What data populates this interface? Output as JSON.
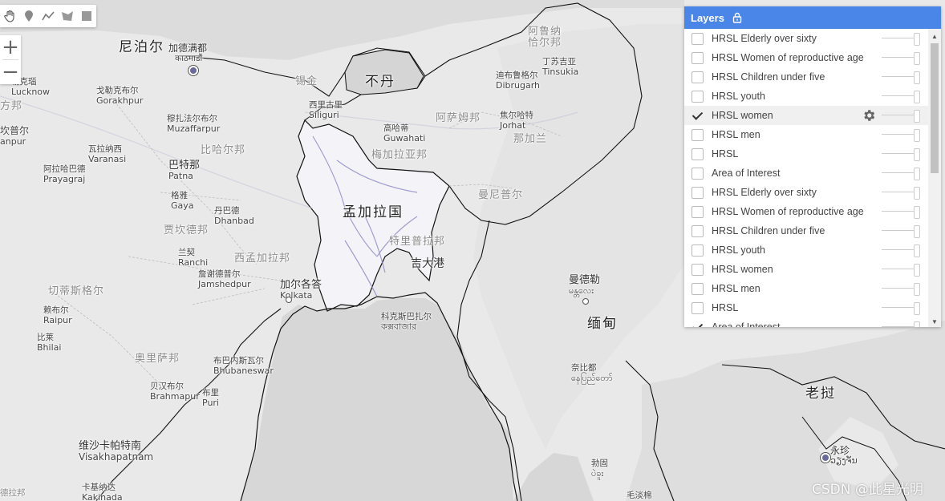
{
  "toolbar": {
    "tools": [
      {
        "name": "pan-hand-icon"
      },
      {
        "name": "marker-pin-icon"
      },
      {
        "name": "draw-line-icon"
      },
      {
        "name": "draw-polygon-icon"
      },
      {
        "name": "draw-rectangle-icon"
      }
    ]
  },
  "zoom": {
    "in_label": "+",
    "out_label": "−"
  },
  "layers_panel": {
    "title": "Layers",
    "lock_icon": "lock-icon",
    "accent_color": "#4a86e8",
    "items": [
      {
        "label": "HRSL Elderly over sixty",
        "checked": false
      },
      {
        "label": "HRSL Women of reproductive age",
        "checked": false
      },
      {
        "label": "HRSL Children under five",
        "checked": false
      },
      {
        "label": "HRSL youth",
        "checked": false
      },
      {
        "label": "HRSL women",
        "checked": true
      },
      {
        "label": "HRSL men",
        "checked": false
      },
      {
        "label": "HRSL",
        "checked": false
      },
      {
        "label": "Area of Interest",
        "checked": false
      },
      {
        "label": "HRSL Elderly over sixty",
        "checked": false
      },
      {
        "label": "HRSL Women of reproductive age",
        "checked": false
      },
      {
        "label": "HRSL Children under five",
        "checked": false
      },
      {
        "label": "HRSL youth",
        "checked": false
      },
      {
        "label": "HRSL women",
        "checked": false
      },
      {
        "label": "HRSL men",
        "checked": false
      },
      {
        "label": "HRSL",
        "checked": false
      },
      {
        "label": "Area of Interest",
        "checked": true
      }
    ]
  },
  "map": {
    "labels": {
      "nepal": "尼泊尔",
      "kathmandu_cn": "加德满都",
      "kathmandu_local": "काठमाडौं",
      "bhutan": "不丹",
      "sikkim": "锡金",
      "siliguri_cn": "西里古里",
      "siliguri": "Siliguri",
      "arunachal": "阿鲁纳",
      "arunachal2": "恰尔邦",
      "tinsukia_cn": "丁苏吉亚",
      "tinsukia": "Tinsukia",
      "dibrugarh_cn": "迪布鲁格尔",
      "dibrugarh": "Dibrugarh",
      "lucknow_cn": "勒克瑙",
      "lucknow": "Lucknow",
      "gorakhpur_cn": "戈勒克布尔",
      "gorakhpur": "Gorakhpur",
      "up_partial": "方邦",
      "kanpur_cn": "坎普尔",
      "kanpur": "anpur",
      "muzaffarpur_cn": "穆扎法尔布尔",
      "muzaffarpur": "Muzaffarpur",
      "bihar": "比哈尔邦",
      "varanasi_cn": "瓦拉纳西",
      "varanasi": "Varanasi",
      "prayagraj_cn": "阿拉哈巴德",
      "prayagraj": "Prayagraj",
      "patna_cn": "巴特那",
      "patna": "Patna",
      "gaya_cn": "格雅",
      "gaya": "Gaya",
      "dhanbad_cn": "丹巴德",
      "dhanbad": "Dhanbad",
      "jharkhand": "贾坎德邦",
      "ranchi_cn": "兰契",
      "ranchi": "Ranchi",
      "jamshedpur_cn": "詹谢德普尔",
      "jamshedpur": "Jamshedpur",
      "west_bengal": "西孟加拉邦",
      "kolkata_cn": "加尔各答",
      "kolkata": "Kolkata",
      "chhattisgarh": "切蒂斯格尔",
      "raipur_cn": "赖布尔",
      "raipur": "Raipur",
      "bhilai_cn": "比莱",
      "bhilai": "Bhilai",
      "odisha": "奥里萨邦",
      "bhubaneswar_cn": "布巴内斯瓦尔",
      "bhubaneswar": "Bhubaneswar",
      "brahmapur_cn": "贝汉布尔",
      "brahmapur": "Brahmapur",
      "puri_cn": "布里",
      "puri": "Puri",
      "visakhapatnam_cn": "维沙卡帕特南",
      "visakhapatnam": "Visakhapatnam",
      "kakinada_cn": "卡基纳达",
      "kakinada": "Kakinada",
      "ap_partial": "德拉邦",
      "bangladesh": "孟加拉国",
      "guwahati_cn": "高哈蒂",
      "guwahati": "Guwahati",
      "assam": "阿萨姆邦",
      "meghalaya": "梅加拉亚邦",
      "jorhat_cn": "焦尔哈特",
      "jorhat": "Jorhat",
      "nagaland_partial": "那加兰",
      "manipur": "曼尼普尔",
      "tripura": "特里普拉邦",
      "chittagong": "吉大港",
      "coxs_cn": "科克斯巴扎尔",
      "coxs_local": "কক্সবাজার",
      "mandalay_cn": "曼德勒",
      "mandalay_local": "မန္တလေး",
      "myanmar": "缅甸",
      "naypyidaw_cn": "奈比都",
      "naypyidaw_local": "နေပြည်တော်",
      "laos": "老挝",
      "vientiane_cn": "永珍",
      "vientiane_local": "ວຽງຈັນ",
      "yangon_cn": "勃固",
      "yangon_local": "ပဲခူး",
      "mawlamyine": "毛淡棉"
    }
  },
  "watermark": "CSDN @此星光明"
}
